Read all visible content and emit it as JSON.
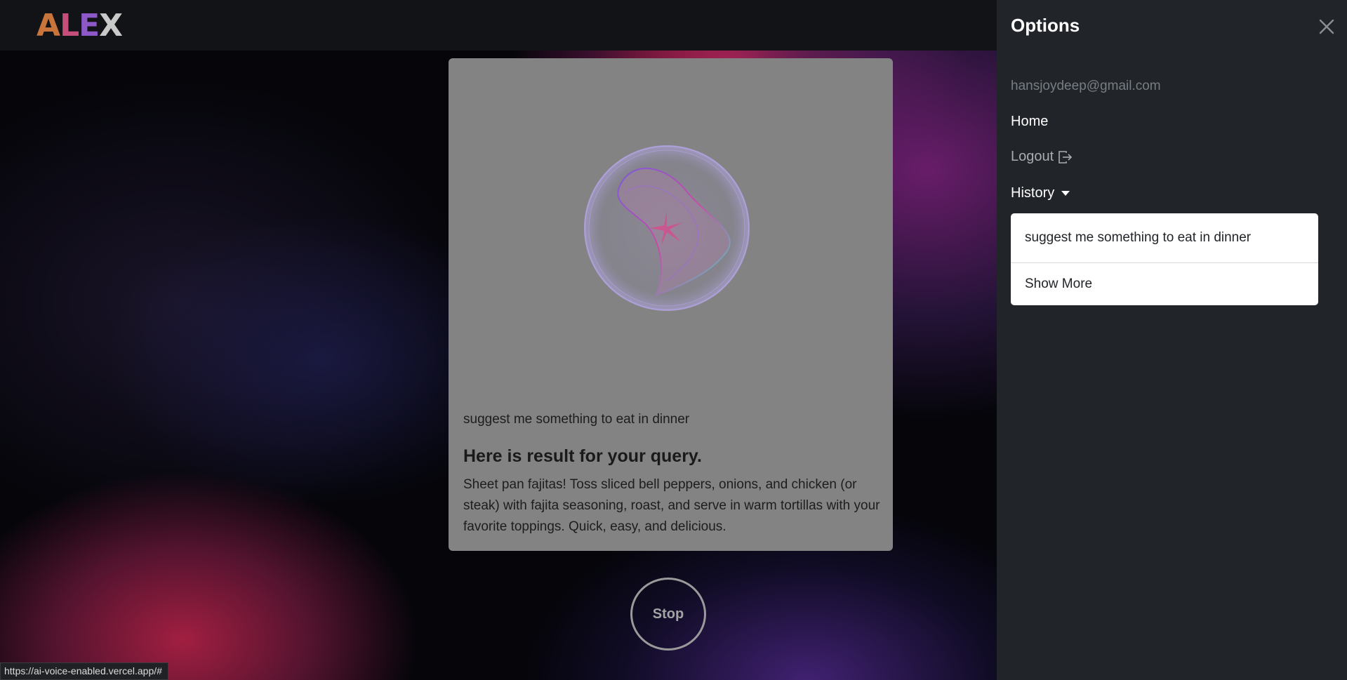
{
  "app": {
    "logo_letters": [
      "A",
      "L",
      "E",
      "X"
    ]
  },
  "main": {
    "query": "suggest me something to eat in dinner",
    "result_heading": "Here is result for your query.",
    "result_body": "Sheet pan fajitas! Toss sliced bell peppers, onions, and chicken (or steak) with fajita seasoning, roast, and serve in warm tortillas with your favorite toppings. Quick, easy, and delicious.",
    "stop_label": "Stop"
  },
  "sidebar": {
    "title": "Options",
    "email": "hansjoydeep@gmail.com",
    "home_label": "Home",
    "logout_label": "Logout",
    "history_label": "History",
    "history_items": [
      "suggest me something to eat in dinner"
    ],
    "show_more_label": "Show More"
  },
  "status_bar": {
    "url": "https://ai-voice-enabled.vercel.app/#"
  },
  "icons": {
    "close": "close-icon",
    "logout": "logout-icon",
    "caret": "caret-down-icon",
    "orb": "voice-orb"
  },
  "colors": {
    "sidebar_bg": "#212529",
    "card_bg": "#838383",
    "header_bg": "#121316"
  }
}
